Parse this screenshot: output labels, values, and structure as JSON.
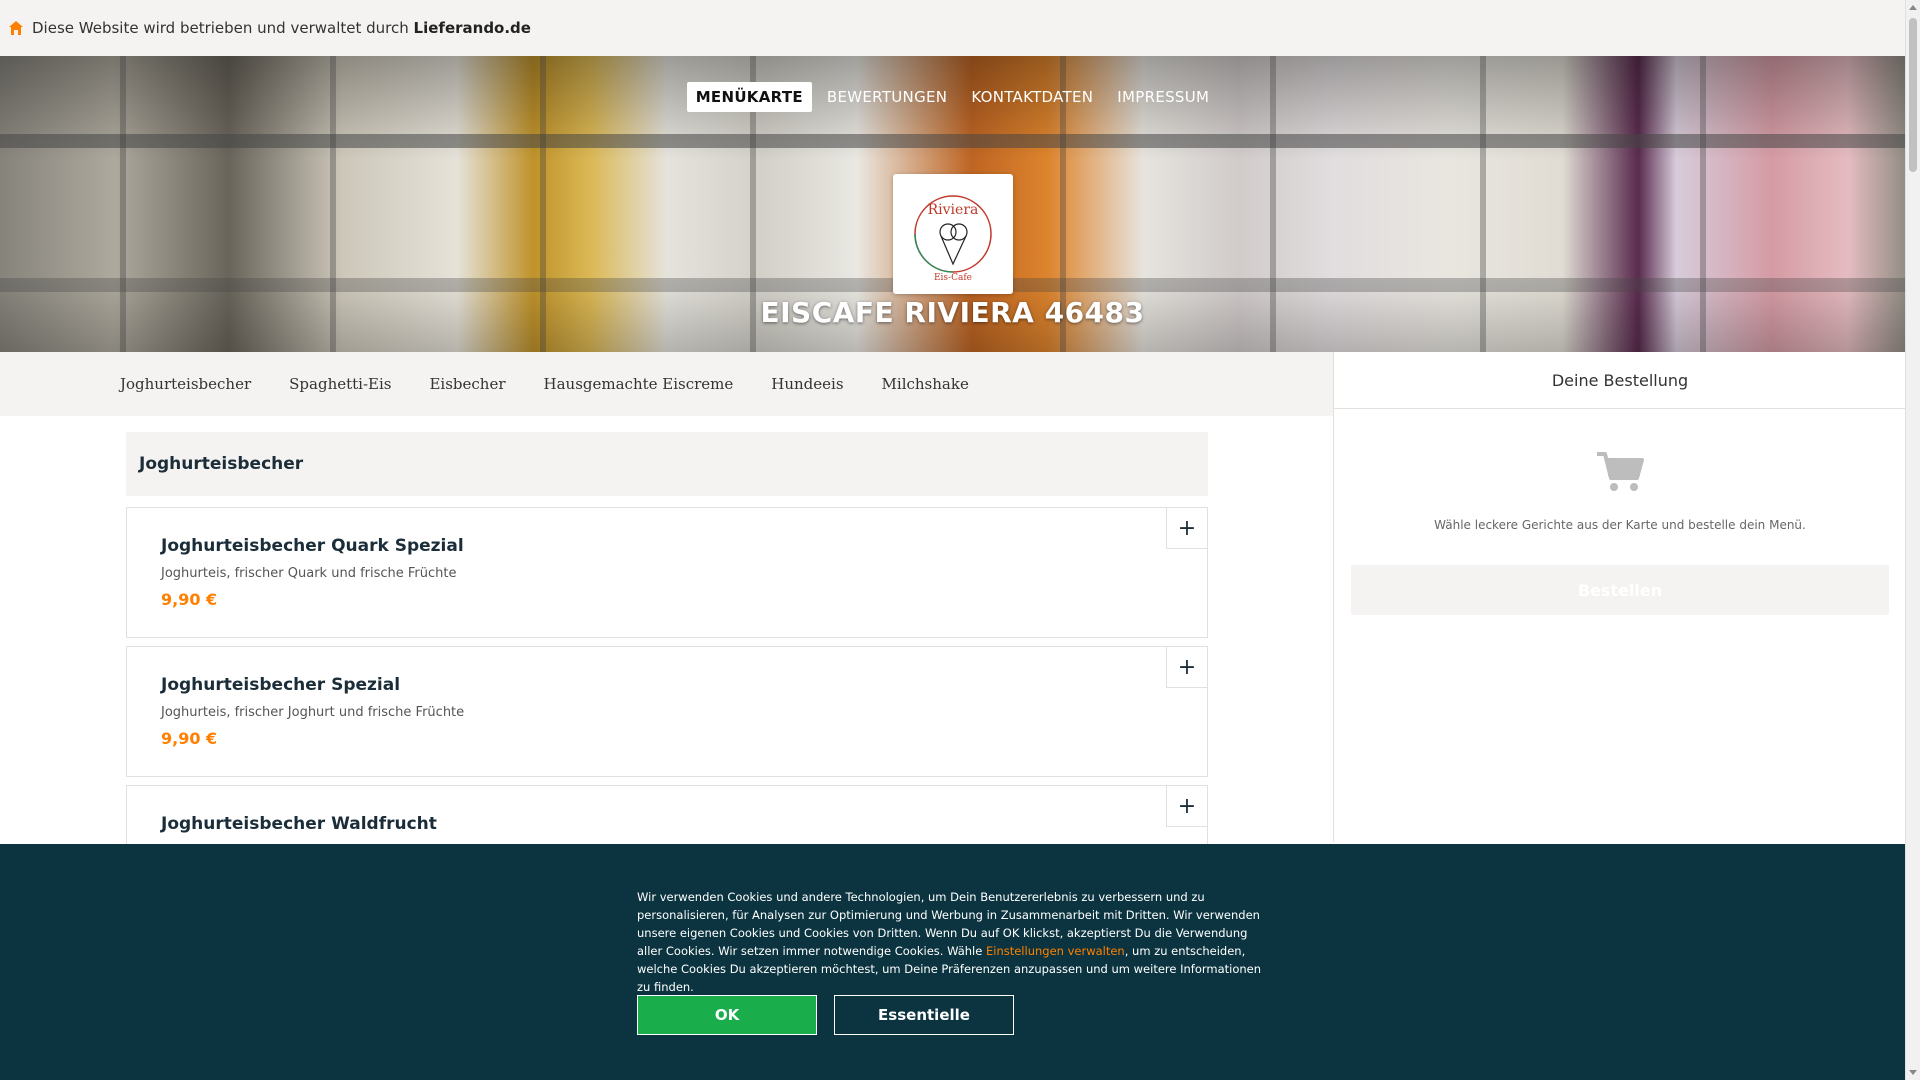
{
  "banner": {
    "text": "Diese Website wird betrieben und verwaltet durch",
    "brand": "Lieferando.de",
    "icon": "home-icon"
  },
  "nav": {
    "tabs": [
      "MENÜKARTE",
      "BEWERTUNGEN",
      "KONTAKTDATEN",
      "IMPRESSUM"
    ],
    "active": "MENÜKARTE"
  },
  "restaurant": {
    "name": "EISCAFE RIVIERA 46483",
    "logo": {
      "top": "Riviera",
      "bottom": "Eis-Cafe"
    }
  },
  "categories": [
    "Joghurteisbecher",
    "Spaghetti-Eis",
    "Eisbecher",
    "Hausgemachte Eiscreme",
    "Hundeeis",
    "Milchshake"
  ],
  "menu": {
    "section_title": "Joghurteisbecher",
    "items": [
      {
        "name": "Joghurteisbecher Quark Spezial",
        "description": "Joghurteis, frischer Quark und frische Früchte",
        "price": "9,90 €"
      },
      {
        "name": "Joghurteisbecher Spezial",
        "description": "Joghurteis, frischer Joghurt und frische Früchte",
        "price": "9,90 €"
      },
      {
        "name": "Joghurteisbecher Waldfrucht",
        "description": "",
        "price": ""
      }
    ],
    "add_label": "+"
  },
  "order": {
    "title": "Deine Bestellung",
    "hint": "Wähle leckere Gerichte aus der Karte und bestelle dein Menü.",
    "button": "Bestellen",
    "icon": "cart-icon"
  },
  "cookie": {
    "text_before": "Wir verwenden Cookies und andere Technologien, um Dein Benutzererlebnis zu verbessern und zu personalisieren, für Analysen zur Optimierung und Werbung in Zusammenarbeit mit Dritten. Wir verwenden unsere eigenen Cookies und Cookies von Dritten. Wenn Du auf OK klickst, akzeptierst Du die Verwendung aller Cookies. Wir setzen immer notwendige Cookies. Wähle ",
    "link": "Einstellungen verwalten",
    "text_after": ", um zu entscheiden, welche Cookies Du akzeptieren möchtest, um Deine Präferenzen anzupassen und um weitere Informationen zu finden.",
    "ok": "OK",
    "essential": "Essentielle"
  },
  "colors": {
    "accent": "#ff8000",
    "dark": "#0b3440",
    "ok_green": "#19ad4b",
    "panel_bg": "#f5f3f1"
  }
}
